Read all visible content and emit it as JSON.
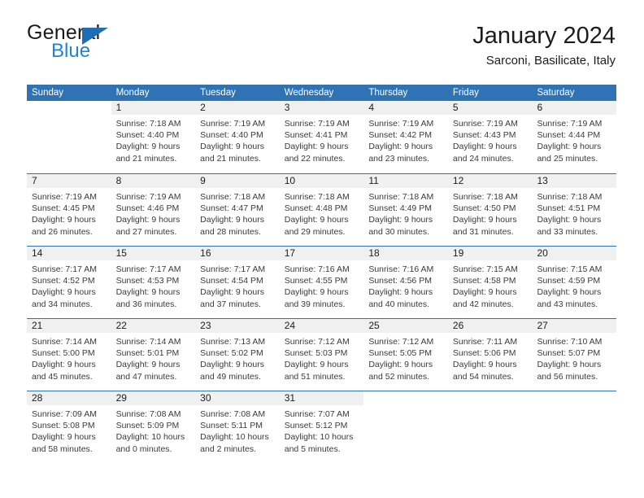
{
  "brand": {
    "word1": "General",
    "word2": "Blue",
    "triangle_color": "#1f6eb5",
    "blue_text_color": "#1f84d6"
  },
  "header": {
    "title": "January 2024",
    "subtitle": "Sarconi, Basilicate, Italy"
  },
  "theme": {
    "header_blue": "#3073b5",
    "daynum_stripe": "#f0f0f0",
    "text": "#3a3a3a"
  },
  "weekdays": [
    "Sunday",
    "Monday",
    "Tuesday",
    "Wednesday",
    "Thursday",
    "Friday",
    "Saturday"
  ],
  "labels": {
    "sunrise_prefix": "Sunrise:",
    "sunset_prefix": "Sunset:",
    "daylight_prefix": "Daylight:"
  },
  "weeks": [
    [
      {
        "day": "",
        "line1": "",
        "line2": "",
        "line3": "",
        "line4": ""
      },
      {
        "day": "1",
        "line1": "Sunrise: 7:18 AM",
        "line2": "Sunset: 4:40 PM",
        "line3": "Daylight: 9 hours",
        "line4": "and 21 minutes."
      },
      {
        "day": "2",
        "line1": "Sunrise: 7:19 AM",
        "line2": "Sunset: 4:40 PM",
        "line3": "Daylight: 9 hours",
        "line4": "and 21 minutes."
      },
      {
        "day": "3",
        "line1": "Sunrise: 7:19 AM",
        "line2": "Sunset: 4:41 PM",
        "line3": "Daylight: 9 hours",
        "line4": "and 22 minutes."
      },
      {
        "day": "4",
        "line1": "Sunrise: 7:19 AM",
        "line2": "Sunset: 4:42 PM",
        "line3": "Daylight: 9 hours",
        "line4": "and 23 minutes."
      },
      {
        "day": "5",
        "line1": "Sunrise: 7:19 AM",
        "line2": "Sunset: 4:43 PM",
        "line3": "Daylight: 9 hours",
        "line4": "and 24 minutes."
      },
      {
        "day": "6",
        "line1": "Sunrise: 7:19 AM",
        "line2": "Sunset: 4:44 PM",
        "line3": "Daylight: 9 hours",
        "line4": "and 25 minutes."
      }
    ],
    [
      {
        "day": "7",
        "line1": "Sunrise: 7:19 AM",
        "line2": "Sunset: 4:45 PM",
        "line3": "Daylight: 9 hours",
        "line4": "and 26 minutes."
      },
      {
        "day": "8",
        "line1": "Sunrise: 7:19 AM",
        "line2": "Sunset: 4:46 PM",
        "line3": "Daylight: 9 hours",
        "line4": "and 27 minutes."
      },
      {
        "day": "9",
        "line1": "Sunrise: 7:18 AM",
        "line2": "Sunset: 4:47 PM",
        "line3": "Daylight: 9 hours",
        "line4": "and 28 minutes."
      },
      {
        "day": "10",
        "line1": "Sunrise: 7:18 AM",
        "line2": "Sunset: 4:48 PM",
        "line3": "Daylight: 9 hours",
        "line4": "and 29 minutes."
      },
      {
        "day": "11",
        "line1": "Sunrise: 7:18 AM",
        "line2": "Sunset: 4:49 PM",
        "line3": "Daylight: 9 hours",
        "line4": "and 30 minutes."
      },
      {
        "day": "12",
        "line1": "Sunrise: 7:18 AM",
        "line2": "Sunset: 4:50 PM",
        "line3": "Daylight: 9 hours",
        "line4": "and 31 minutes."
      },
      {
        "day": "13",
        "line1": "Sunrise: 7:18 AM",
        "line2": "Sunset: 4:51 PM",
        "line3": "Daylight: 9 hours",
        "line4": "and 33 minutes."
      }
    ],
    [
      {
        "day": "14",
        "line1": "Sunrise: 7:17 AM",
        "line2": "Sunset: 4:52 PM",
        "line3": "Daylight: 9 hours",
        "line4": "and 34 minutes."
      },
      {
        "day": "15",
        "line1": "Sunrise: 7:17 AM",
        "line2": "Sunset: 4:53 PM",
        "line3": "Daylight: 9 hours",
        "line4": "and 36 minutes."
      },
      {
        "day": "16",
        "line1": "Sunrise: 7:17 AM",
        "line2": "Sunset: 4:54 PM",
        "line3": "Daylight: 9 hours",
        "line4": "and 37 minutes."
      },
      {
        "day": "17",
        "line1": "Sunrise: 7:16 AM",
        "line2": "Sunset: 4:55 PM",
        "line3": "Daylight: 9 hours",
        "line4": "and 39 minutes."
      },
      {
        "day": "18",
        "line1": "Sunrise: 7:16 AM",
        "line2": "Sunset: 4:56 PM",
        "line3": "Daylight: 9 hours",
        "line4": "and 40 minutes."
      },
      {
        "day": "19",
        "line1": "Sunrise: 7:15 AM",
        "line2": "Sunset: 4:58 PM",
        "line3": "Daylight: 9 hours",
        "line4": "and 42 minutes."
      },
      {
        "day": "20",
        "line1": "Sunrise: 7:15 AM",
        "line2": "Sunset: 4:59 PM",
        "line3": "Daylight: 9 hours",
        "line4": "and 43 minutes."
      }
    ],
    [
      {
        "day": "21",
        "line1": "Sunrise: 7:14 AM",
        "line2": "Sunset: 5:00 PM",
        "line3": "Daylight: 9 hours",
        "line4": "and 45 minutes."
      },
      {
        "day": "22",
        "line1": "Sunrise: 7:14 AM",
        "line2": "Sunset: 5:01 PM",
        "line3": "Daylight: 9 hours",
        "line4": "and 47 minutes."
      },
      {
        "day": "23",
        "line1": "Sunrise: 7:13 AM",
        "line2": "Sunset: 5:02 PM",
        "line3": "Daylight: 9 hours",
        "line4": "and 49 minutes."
      },
      {
        "day": "24",
        "line1": "Sunrise: 7:12 AM",
        "line2": "Sunset: 5:03 PM",
        "line3": "Daylight: 9 hours",
        "line4": "and 51 minutes."
      },
      {
        "day": "25",
        "line1": "Sunrise: 7:12 AM",
        "line2": "Sunset: 5:05 PM",
        "line3": "Daylight: 9 hours",
        "line4": "and 52 minutes."
      },
      {
        "day": "26",
        "line1": "Sunrise: 7:11 AM",
        "line2": "Sunset: 5:06 PM",
        "line3": "Daylight: 9 hours",
        "line4": "and 54 minutes."
      },
      {
        "day": "27",
        "line1": "Sunrise: 7:10 AM",
        "line2": "Sunset: 5:07 PM",
        "line3": "Daylight: 9 hours",
        "line4": "and 56 minutes."
      }
    ],
    [
      {
        "day": "28",
        "line1": "Sunrise: 7:09 AM",
        "line2": "Sunset: 5:08 PM",
        "line3": "Daylight: 9 hours",
        "line4": "and 58 minutes."
      },
      {
        "day": "29",
        "line1": "Sunrise: 7:08 AM",
        "line2": "Sunset: 5:09 PM",
        "line3": "Daylight: 10 hours",
        "line4": "and 0 minutes."
      },
      {
        "day": "30",
        "line1": "Sunrise: 7:08 AM",
        "line2": "Sunset: 5:11 PM",
        "line3": "Daylight: 10 hours",
        "line4": "and 2 minutes."
      },
      {
        "day": "31",
        "line1": "Sunrise: 7:07 AM",
        "line2": "Sunset: 5:12 PM",
        "line3": "Daylight: 10 hours",
        "line4": "and 5 minutes."
      },
      {
        "day": "",
        "line1": "",
        "line2": "",
        "line3": "",
        "line4": ""
      },
      {
        "day": "",
        "line1": "",
        "line2": "",
        "line3": "",
        "line4": ""
      },
      {
        "day": "",
        "line1": "",
        "line2": "",
        "line3": "",
        "line4": ""
      }
    ]
  ]
}
